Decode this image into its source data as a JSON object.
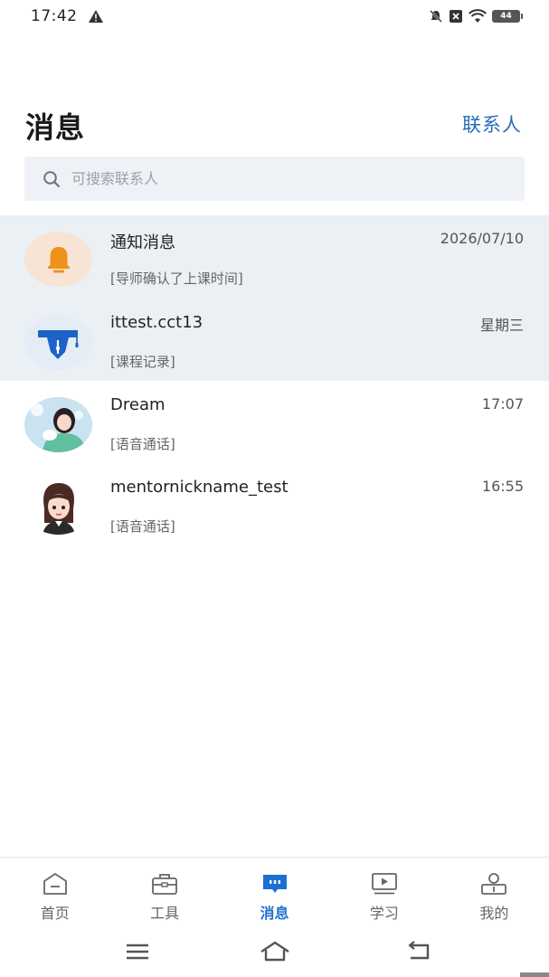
{
  "status_bar": {
    "time": "17:42",
    "battery": "44",
    "icons": [
      "warning-icon",
      "mute-icon",
      "close-box-icon",
      "wifi-icon",
      "battery-icon"
    ]
  },
  "header": {
    "title": "消息",
    "contacts_link": "联系人",
    "accent_color": "#2a6bb8"
  },
  "search": {
    "placeholder": "可搜索联系人",
    "value": ""
  },
  "conversations": [
    {
      "name": "通知消息",
      "time": "2026/07/10",
      "preview": "[导师确认了上课时间]",
      "avatar": "bell-avatar",
      "pinned": true
    },
    {
      "name": "ittest.cct13",
      "time": "星期三",
      "preview": "[课程记录]",
      "avatar": "graduation-cap-avatar",
      "pinned": true
    },
    {
      "name": "Dream",
      "time": "17:07",
      "preview": "[语音通话]",
      "avatar": "user-photo-avatar",
      "pinned": false
    },
    {
      "name": "mentornickname_test",
      "time": "16:55",
      "preview": "[语音通话]",
      "avatar": "cartoon-girl-avatar",
      "pinned": false
    }
  ],
  "tabs": [
    {
      "label": "首页",
      "icon": "home-icon",
      "active": false
    },
    {
      "label": "工具",
      "icon": "toolbox-icon",
      "active": false
    },
    {
      "label": "消息",
      "icon": "message-icon",
      "active": true
    },
    {
      "label": "学习",
      "icon": "video-play-icon",
      "active": false
    },
    {
      "label": "我的",
      "icon": "person-icon",
      "active": false
    }
  ],
  "colors": {
    "active_tab": "#1e6fd0",
    "pinned_bg": "#ebf0f4",
    "search_bg": "#eef2f6"
  }
}
